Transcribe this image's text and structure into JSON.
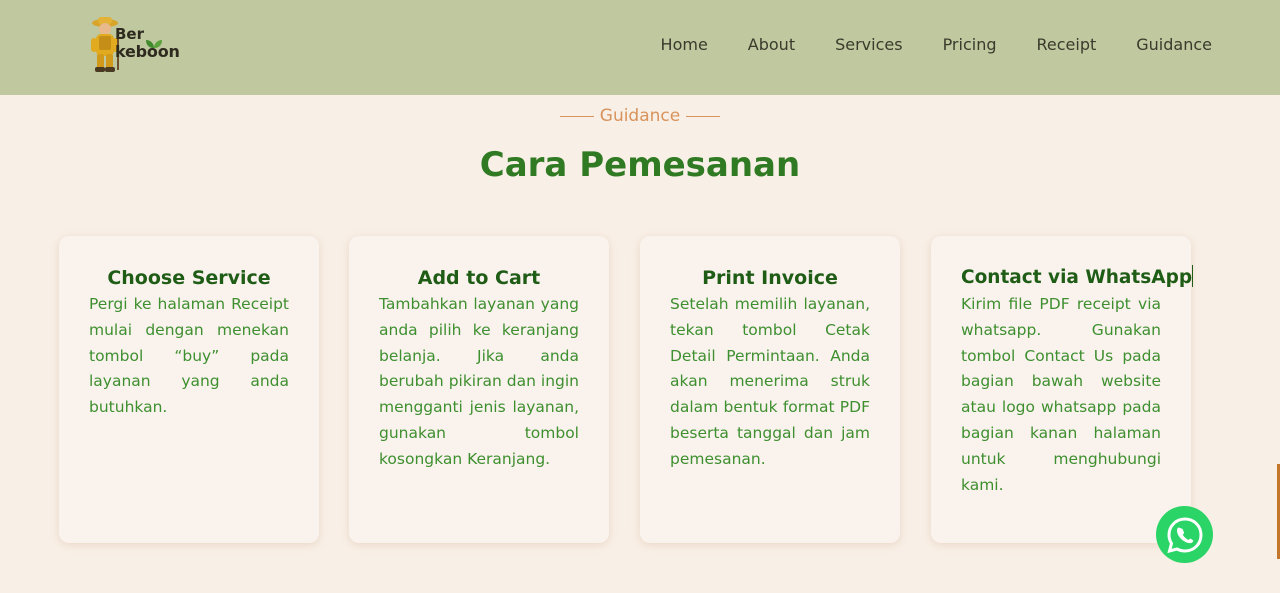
{
  "brand": {
    "line1": "Ber",
    "line2": "keboon"
  },
  "nav": [
    "Home",
    "About",
    "Services",
    "Pricing",
    "Receipt",
    "Guidance"
  ],
  "section": {
    "kicker": "Guidance",
    "title": "Cara Pemesanan"
  },
  "cards": [
    {
      "title": "Choose Service",
      "text": "Pergi ke halaman Receipt mulai dengan menekan tombol “buy” pada layanan yang anda butuhkan."
    },
    {
      "title": "Add to Cart",
      "text": "Tambahkan layanan yang anda pilih ke keranjang belanja. Jika anda berubah pikiran dan ingin mengganti jenis layanan, gunakan tombol kosongkan Keranjang."
    },
    {
      "title": "Print Invoice",
      "text": "Setelah memilih layanan, tekan tombol Cetak Detail Permintaan. Anda akan menerima struk dalam bentuk format PDF beserta tanggal dan jam pemesanan."
    },
    {
      "title": "Contact via WhatsApp",
      "text": "Kirim file PDF receipt via whatsapp. Gunakan tombol Contact Us pada bagian bawah website atau logo whatsapp pada bagian kanan halaman untuk menghubungi kami."
    }
  ],
  "icons": {
    "logo": "farmer-mascot-icon",
    "whatsapp": "whatsapp-icon"
  },
  "colors": {
    "navbar": "#bfc89f",
    "background": "#f8efe6",
    "accent": "#d8935c",
    "heading": "#2f7a22",
    "whatsapp": "#2ad466"
  }
}
